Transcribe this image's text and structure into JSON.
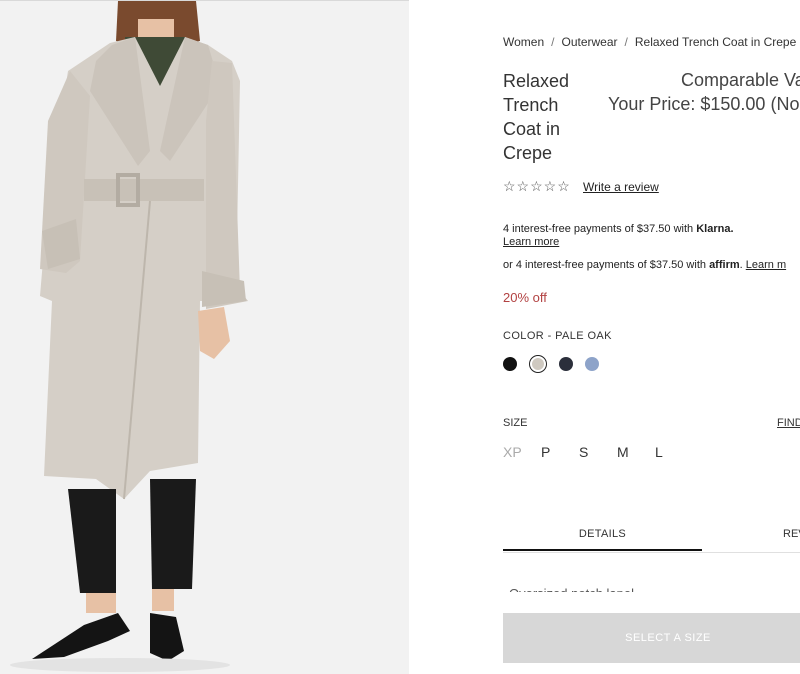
{
  "breadcrumb": [
    "Women",
    "Outerwear",
    "Relaxed Trench Coat in Crepe"
  ],
  "product": {
    "title": "Relaxed Trench Coat in Crepe",
    "comparable_value": "Comparable Va",
    "price": "Your Price: $150.00 (No"
  },
  "reviews": {
    "stars": "☆☆☆☆☆",
    "write_label": "Write a review"
  },
  "payments": {
    "klarna_text": "4 interest-free payments of $37.50 with ",
    "klarna_brand": "Klarna.",
    "learn_more_1": "Learn more",
    "affirm_text": "or 4 interest-free payments of $37.50 with ",
    "affirm_brand": "affirm",
    "learn_more_2": "Learn m"
  },
  "discount": "20% off",
  "color": {
    "label": "COLOR - PALE OAK",
    "swatches": [
      {
        "name": "Black",
        "hex": "#111111"
      },
      {
        "name": "Pale Oak",
        "hex": "#cfc9c0"
      },
      {
        "name": "Navy",
        "hex": "#2b2f3b"
      },
      {
        "name": "Blue",
        "hex": "#8da3c9"
      }
    ]
  },
  "size": {
    "label": "SIZE",
    "find_label": "FIND",
    "options": [
      "XP",
      "P",
      "S",
      "M",
      "L"
    ]
  },
  "tabs": {
    "details": "DETAILS",
    "reviews": "REV"
  },
  "details_partial": "Oversized notch lapel",
  "cta": "SELECT A SIZE"
}
